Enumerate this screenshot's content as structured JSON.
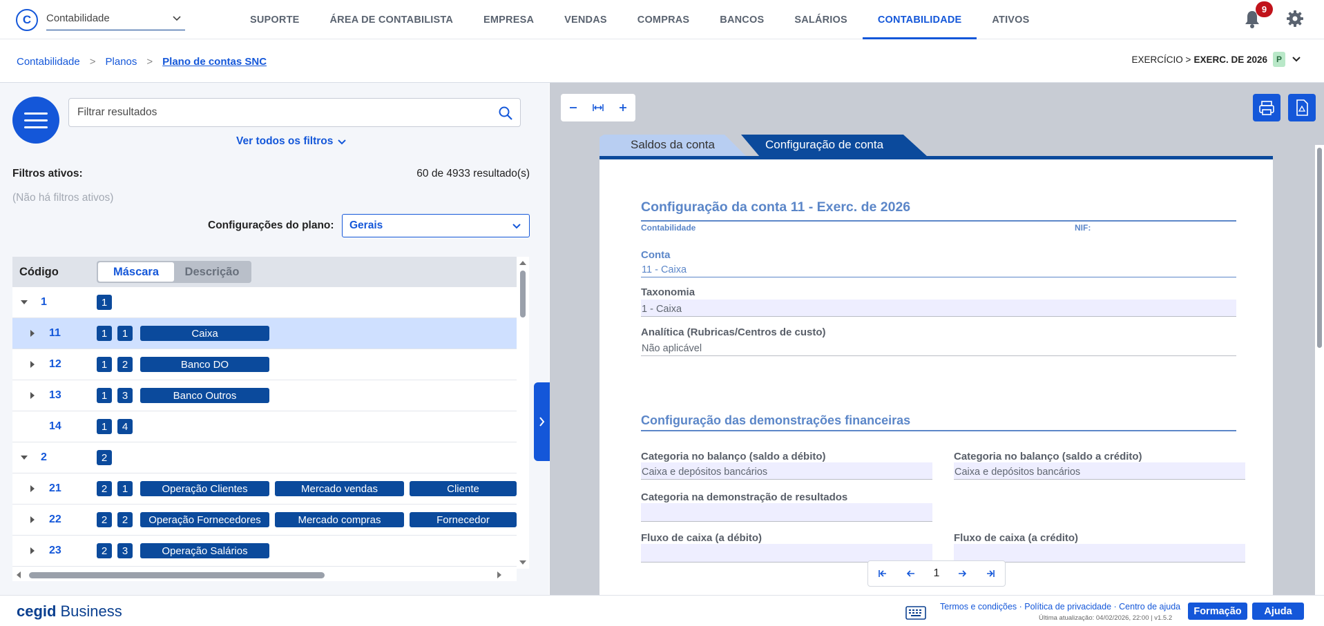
{
  "app": {
    "logo_letter": "C",
    "selector_value": "Contabilidade"
  },
  "nav": {
    "items": [
      {
        "label": "SUPORTE",
        "active": false
      },
      {
        "label": "ÁREA DE CONTABILISTA",
        "active": false
      },
      {
        "label": "EMPRESA",
        "active": false
      },
      {
        "label": "VENDAS",
        "active": false
      },
      {
        "label": "COMPRAS",
        "active": false
      },
      {
        "label": "BANCOS",
        "active": false
      },
      {
        "label": "SALÁRIOS",
        "active": false
      },
      {
        "label": "CONTABILIDADE",
        "active": true
      },
      {
        "label": "ATIVOS",
        "active": false
      }
    ],
    "notifications_count": "9"
  },
  "breadcrumb": {
    "items": [
      "Contabilidade",
      "Planos"
    ],
    "current": "Plano de contas SNC",
    "separator": ">"
  },
  "exercise": {
    "label": "EXERCÍCIO >",
    "value": "EXERC. DE 2026",
    "badge": "P"
  },
  "filters": {
    "search_placeholder": "Filtrar resultados",
    "see_all": "Ver todos os filtros",
    "active_label": "Filtros ativos:",
    "result_count": "60 de 4933 resultado(s)",
    "none_active": "(Não há filtros ativos)",
    "plan_config_label": "Configurações do plano:",
    "plan_config_value": "Gerais"
  },
  "tree": {
    "code_header": "Código",
    "toggle": [
      "Máscara",
      "Descrição"
    ],
    "rows": [
      {
        "code": "1",
        "level": 0,
        "expander": "down",
        "mask": [
          "1"
        ],
        "labels": []
      },
      {
        "code": "11",
        "level": 1,
        "expander": "right",
        "mask": [
          "1",
          "1"
        ],
        "labels": [
          "Caixa"
        ],
        "selected": true
      },
      {
        "code": "12",
        "level": 1,
        "expander": "right",
        "mask": [
          "1",
          "2"
        ],
        "labels": [
          "Banco DO"
        ]
      },
      {
        "code": "13",
        "level": 1,
        "expander": "right",
        "mask": [
          "1",
          "3"
        ],
        "labels": [
          "Banco Outros"
        ]
      },
      {
        "code": "14",
        "level": 1,
        "expander": "none",
        "mask": [
          "1",
          "4"
        ],
        "labels": []
      },
      {
        "code": "2",
        "level": 0,
        "expander": "down",
        "mask": [
          "2"
        ],
        "labels": []
      },
      {
        "code": "21",
        "level": 1,
        "expander": "right",
        "mask": [
          "2",
          "1"
        ],
        "labels": [
          "Operação Clientes",
          "Mercado vendas",
          "Cliente"
        ]
      },
      {
        "code": "22",
        "level": 1,
        "expander": "right",
        "mask": [
          "2",
          "2"
        ],
        "labels": [
          "Operação Fornecedores",
          "Mercado compras",
          "Fornecedor"
        ]
      },
      {
        "code": "23",
        "level": 1,
        "expander": "right",
        "mask": [
          "2",
          "3"
        ],
        "labels": [
          "Operação Salários"
        ]
      }
    ]
  },
  "viewer": {
    "tabs": [
      "Saldos da conta",
      "Configuração de conta"
    ],
    "active_tab": 1,
    "page_number": "1"
  },
  "document": {
    "title": "Configuração da conta 11 - Exerc. de 2026",
    "company": "Contabilidade",
    "nif_label": "NIF:",
    "account_label": "Conta",
    "account_value": "11 - Caixa",
    "taxonomy_label": "Taxonomia",
    "taxonomy_value": "1 - Caixa",
    "analytic_label": "Analítica (Rubricas/Centros de custo)",
    "analytic_value": "Não aplicável",
    "section_title": "Configuração das demonstrações financeiras",
    "balance_debit_label": "Categoria no balanço (saldo a débito)",
    "balance_debit_value": "Caixa e depósitos bancários",
    "balance_credit_label": "Categoria no balanço (saldo a crédito)",
    "balance_credit_value": "Caixa e depósitos bancários",
    "income_label": "Categoria na demonstração de resultados",
    "income_value": "",
    "cash_debit_label": "Fluxo de caixa (a débito)",
    "cash_debit_value": "",
    "cash_credit_label": "Fluxo de caixa (a crédito)",
    "cash_credit_value": ""
  },
  "footer": {
    "brand_bold": "cegid",
    "brand_rest": "Business",
    "links": "Termos e condições · Política de privacidade · Centro de ajuda",
    "updated": "Última atualização: 04/02/2026, 22:00 | v1.5.2",
    "training": "Formação",
    "help": "Ajuda"
  },
  "colors": {
    "primary": "#1457d9",
    "chip": "#0b4a9c",
    "doc_accent": "#5b86c8",
    "selected_row": "#cfe0ff",
    "notification": "#c1131b"
  }
}
